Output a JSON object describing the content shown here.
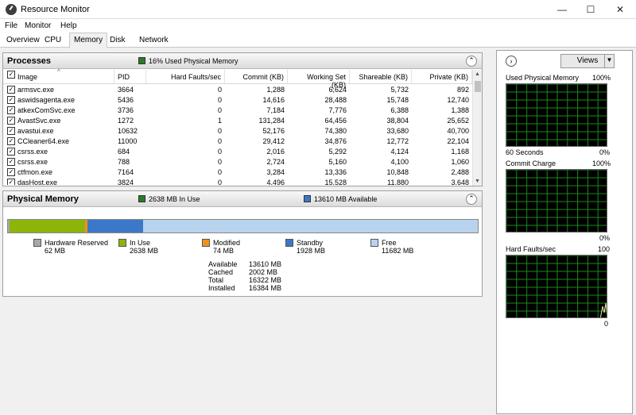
{
  "window": {
    "title": "Resource Monitor",
    "minimize": "—",
    "maximize": "☐",
    "close": "✕"
  },
  "menu": [
    "File",
    "Monitor",
    "Help"
  ],
  "tabs": [
    "Overview",
    "CPU",
    "Memory",
    "Disk",
    "Network"
  ],
  "active_tab": "Memory",
  "colors": {
    "in_use": "#8cb40a",
    "standby": "#3b78c8",
    "free": "#b8d3ee",
    "hardware_reserved": "#a8a8a8",
    "modified": "#f0901e",
    "graph_line": "#1a8a1a"
  },
  "processes": {
    "title": "Processes",
    "status": "16% Used Physical Memory",
    "columns": [
      "Image",
      "PID",
      "Hard Faults/sec",
      "Commit (KB)",
      "Working Set (KB)",
      "Shareable (KB)",
      "Private (KB)"
    ],
    "rows": [
      [
        "armsvc.exe",
        "3664",
        "0",
        "1,288",
        "6,624",
        "5,732",
        "892"
      ],
      [
        "aswidsagenta.exe",
        "5436",
        "0",
        "14,616",
        "28,488",
        "15,748",
        "12,740"
      ],
      [
        "atkexComSvc.exe",
        "3736",
        "0",
        "7,184",
        "7,776",
        "6,388",
        "1,388"
      ],
      [
        "AvastSvc.exe",
        "1272",
        "1",
        "131,284",
        "64,456",
        "38,804",
        "25,652"
      ],
      [
        "avastui.exe",
        "10632",
        "0",
        "52,176",
        "74,380",
        "33,680",
        "40,700"
      ],
      [
        "CCleaner64.exe",
        "11000",
        "0",
        "29,412",
        "34,876",
        "12,772",
        "22,104"
      ],
      [
        "csrss.exe",
        "684",
        "0",
        "2,016",
        "5,292",
        "4,124",
        "1,168"
      ],
      [
        "csrss.exe",
        "788",
        "0",
        "2,724",
        "5,160",
        "4,100",
        "1,060"
      ],
      [
        "ctfmon.exe",
        "7164",
        "0",
        "3,284",
        "13,336",
        "10,848",
        "2,488"
      ],
      [
        "dasHost.exe",
        "3824",
        "0",
        "4,496",
        "15,528",
        "11,880",
        "3,648"
      ]
    ]
  },
  "physical_memory": {
    "title": "Physical Memory",
    "in_use_status": "2638 MB In Use",
    "available_status": "13610 MB Available",
    "bar": {
      "hardware_reserved_mb": 62,
      "in_use_mb": 2638,
      "modified_mb": 74,
      "standby_mb": 1928,
      "free_mb": 11682,
      "total_mb": 16384
    },
    "legend": [
      {
        "label": "Hardware Reserved",
        "value": "62 MB"
      },
      {
        "label": "In Use",
        "value": "2638 MB"
      },
      {
        "label": "Modified",
        "value": "74 MB"
      },
      {
        "label": "Standby",
        "value": "1928 MB"
      },
      {
        "label": "Free",
        "value": "11682 MB"
      }
    ],
    "stats": [
      {
        "label": "Available",
        "value": "13610 MB"
      },
      {
        "label": "Cached",
        "value": "2002 MB"
      },
      {
        "label": "Total",
        "value": "16322 MB"
      },
      {
        "label": "Installed",
        "value": "16384 MB"
      }
    ]
  },
  "sidebar": {
    "views_label": "Views",
    "expand_icon": "chevron-right-icon",
    "graphs": [
      {
        "title": "Used Physical Memory",
        "max": "100%",
        "bottom_left": "60 Seconds",
        "bottom_right": "0%"
      },
      {
        "title": "Commit Charge",
        "max": "100%",
        "bottom_left": "",
        "bottom_right": "0%"
      },
      {
        "title": "Hard Faults/sec",
        "max": "100",
        "bottom_left": "",
        "bottom_right": "0"
      }
    ]
  }
}
